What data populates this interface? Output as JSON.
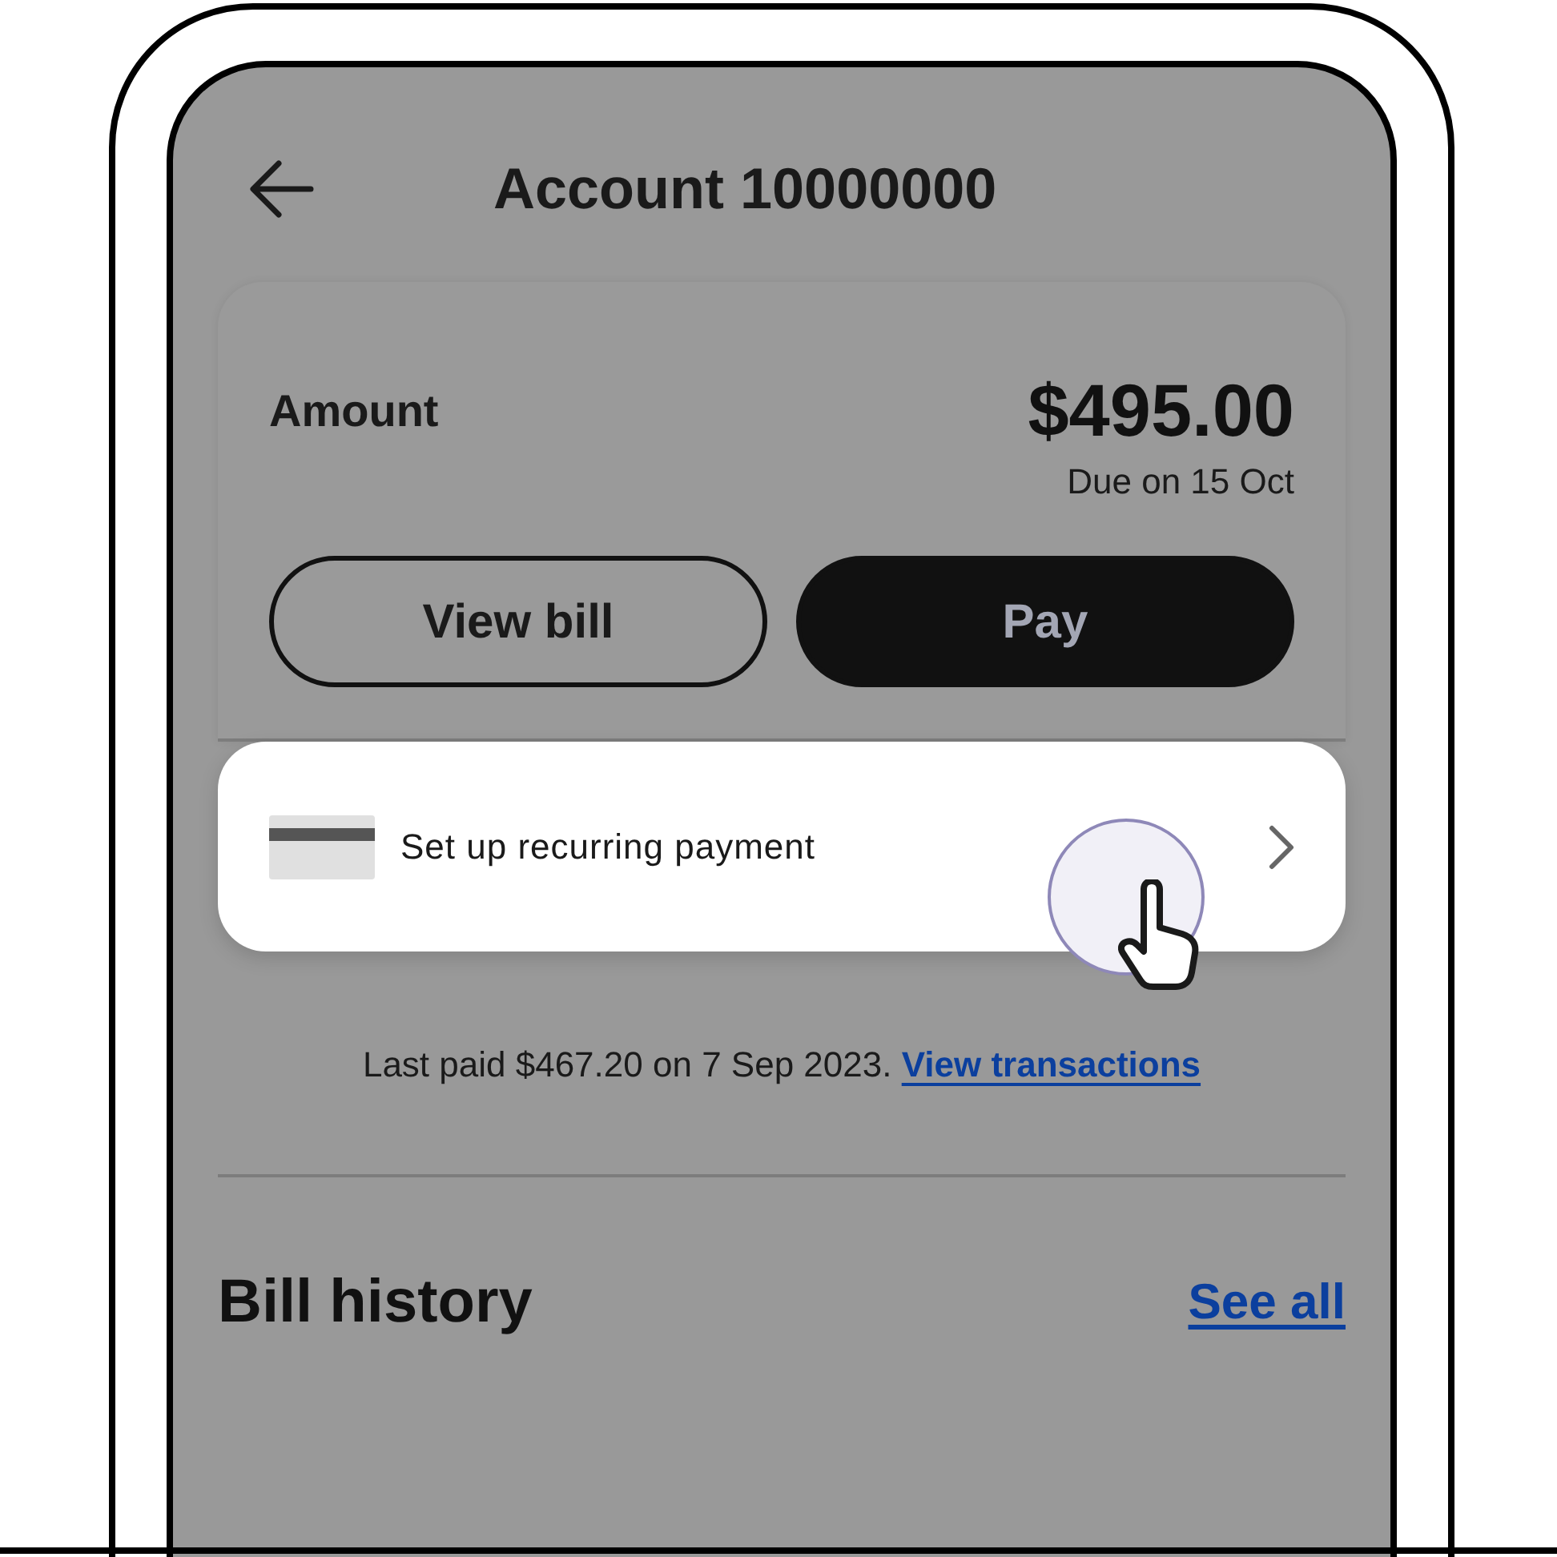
{
  "header": {
    "title": "Account 10000000"
  },
  "amount_card": {
    "label": "Amount",
    "amount": "$495.00",
    "due": "Due on 15 Oct",
    "buttons": [
      {
        "label": "View bill",
        "kind": "outline"
      },
      {
        "label": "Pay",
        "kind": "filled"
      }
    ]
  },
  "recurring_payment": {
    "label": "Set up recurring payment",
    "pressed": true
  },
  "last_paid": {
    "text": "Last paid $467.20 on 7 Sep 2023.",
    "link": "View transactions"
  },
  "bill_history": {
    "title": "Bill history",
    "link": "See all"
  }
}
